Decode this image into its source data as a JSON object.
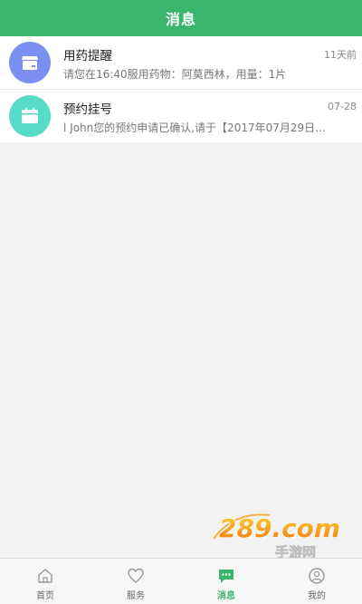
{
  "header": {
    "title": "消息"
  },
  "messages": [
    {
      "title": "用药提醒",
      "time": "11天前",
      "preview": "请您在16:40服用药物：阿莫西林，用量：1片",
      "icon": "medicine-box-icon",
      "icon_bg": "#7b8ff0"
    },
    {
      "title": "预约挂号",
      "time": "07-28",
      "preview": "l John您的预约申请已确认,请于【2017年07月29日...",
      "icon": "calendar-icon",
      "icon_bg": "#56dcc6"
    }
  ],
  "tabbar": {
    "items": [
      {
        "label": "首页",
        "icon": "home-icon",
        "active": false
      },
      {
        "label": "服务",
        "icon": "heart-icon",
        "active": false
      },
      {
        "label": "消息",
        "icon": "chat-bubble-icon",
        "active": true
      },
      {
        "label": "我的",
        "icon": "user-icon",
        "active": false
      }
    ]
  },
  "watermark": {
    "main": "289.com",
    "sub": "手游网"
  },
  "colors": {
    "accent": "#3bb56c",
    "tab_inactive": "#999999"
  }
}
